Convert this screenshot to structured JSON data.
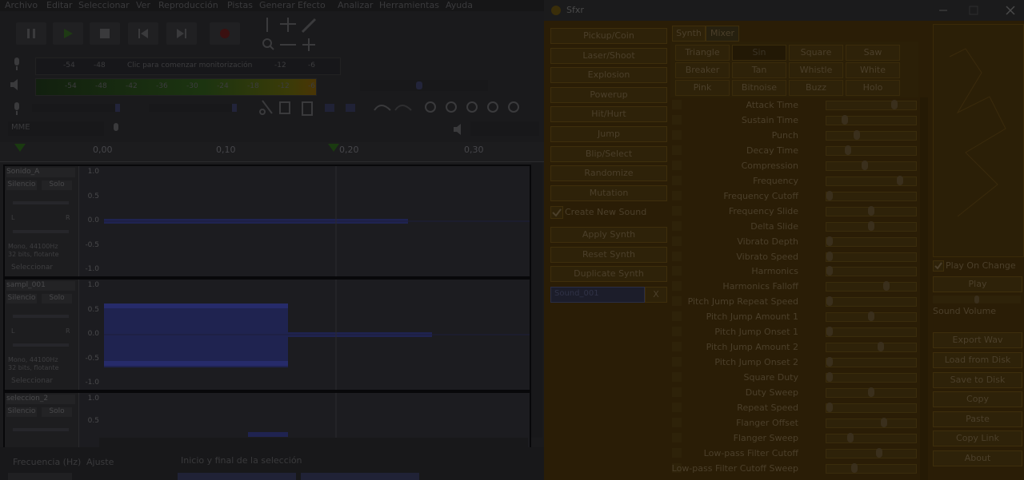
{
  "audacity": {
    "menu": [
      "Archivo",
      "Editar",
      "Seleccionar",
      "Ver",
      "Reproducción",
      "Pistas",
      "Generar",
      "Efecto",
      "Analizar",
      "Herramientas",
      "Ayuda"
    ],
    "meter_message": "Clic para comenzar monitorización",
    "record_meter_ticks": [
      "-54",
      "-48",
      "-12",
      "-6"
    ],
    "play_meter_ticks": [
      "-54",
      "-48",
      "-42",
      "-36",
      "-30",
      "-24",
      "-18",
      "-12",
      "-6"
    ],
    "ruler_ticks": [
      "0,00",
      "0,10",
      "0,20",
      "0,30"
    ],
    "device_label": "MME",
    "tracks": [
      {
        "name": "Sonido_A",
        "silence": "Silencio",
        "solo": "Solo",
        "lr": [
          "L",
          "R"
        ],
        "info1": "Mono, 44100Hz",
        "info2": "32 bits, flotante",
        "select": "Seleccionar",
        "y": [
          "1.0",
          "0.5",
          "0.0",
          "-0.5",
          "-1.0"
        ]
      },
      {
        "name": "sampl_001",
        "silence": "Silencio",
        "solo": "Solo",
        "lr": [
          "L",
          "R"
        ],
        "info1": "Mono, 44100Hz",
        "info2": "32 bits, flotante",
        "select": "Seleccionar",
        "y": [
          "1.0",
          "0.5",
          "0.0",
          "-0.5",
          "-1.0"
        ]
      },
      {
        "name": "seleccion_2",
        "silence": "Silencio",
        "solo": "Solo",
        "y": [
          "1.0",
          "0.5"
        ]
      }
    ],
    "bottom": {
      "freq": "Frecuencia (Hz)",
      "snap": "Ajuste",
      "selection": "Inicio y final de la selección"
    }
  },
  "sfxr": {
    "title": "Sfxr",
    "generators": [
      "Pickup/Coin",
      "Laser/Shoot",
      "Explosion",
      "Powerup",
      "Hit/Hurt",
      "Jump",
      "Blip/Select",
      "Randomize",
      "Mutation"
    ],
    "create_new": "Create New Sound",
    "actions": [
      "Apply Synth",
      "Reset Synth",
      "Duplicate Synth"
    ],
    "sound_name": "Sound_001",
    "close_x": "X",
    "tabs": [
      "Synth",
      "Mixer"
    ],
    "waves": [
      [
        "Triangle",
        "Sin",
        "Square",
        "Saw"
      ],
      [
        "Breaker",
        "Tan",
        "Whistle",
        "White"
      ],
      [
        "Pink",
        "Bitnoise",
        "Buzz",
        "Holo"
      ]
    ],
    "selected_wave": "Sin",
    "params": [
      {
        "label": "Attack Time",
        "v": 0.78
      },
      {
        "label": "Sustain Time",
        "v": 0.18
      },
      {
        "label": "Punch",
        "v": 0.33
      },
      {
        "label": "Decay Time",
        "v": 0.22
      },
      {
        "label": "Compression",
        "v": 0.42
      },
      {
        "label": "Frequency",
        "v": 0.85
      },
      {
        "label": "Frequency Cutoff",
        "v": 0.0
      },
      {
        "label": "Frequency Slide",
        "v": 0.5
      },
      {
        "label": "Delta Slide",
        "v": 0.5
      },
      {
        "label": "Vibrato Depth",
        "v": 0.0
      },
      {
        "label": "Vibrato Speed",
        "v": 0.0
      },
      {
        "label": "Harmonics",
        "v": 0.0
      },
      {
        "label": "Harmonics Falloff",
        "v": 0.68
      },
      {
        "label": "Pitch Jump Repeat Speed",
        "v": 0.0
      },
      {
        "label": "Pitch Jump Amount 1",
        "v": 0.5
      },
      {
        "label": "Pitch Jump Onset 1",
        "v": 0.0
      },
      {
        "label": "Pitch Jump Amount 2",
        "v": 0.62
      },
      {
        "label": "Pitch Jump Onset 2",
        "v": 0.0
      },
      {
        "label": "Square Duty",
        "v": 0.0
      },
      {
        "label": "Duty Sweep",
        "v": 0.5
      },
      {
        "label": "Repeat Speed",
        "v": 0.0
      },
      {
        "label": "Flanger Offset",
        "v": 0.65
      },
      {
        "label": "Flanger Sweep",
        "v": 0.25
      },
      {
        "label": "Low-pass Filter Cutoff",
        "v": 0.6
      },
      {
        "label": "Low-pass Filter Cutoff Sweep",
        "v": 0.3
      }
    ],
    "play_on_change": "Play On Change",
    "play": "Play",
    "sound_volume": "Sound Volume",
    "right_buttons": [
      "Export Wav",
      "Load from Disk",
      "Save to Disk",
      "Copy",
      "Paste",
      "Copy Link",
      "About"
    ]
  }
}
